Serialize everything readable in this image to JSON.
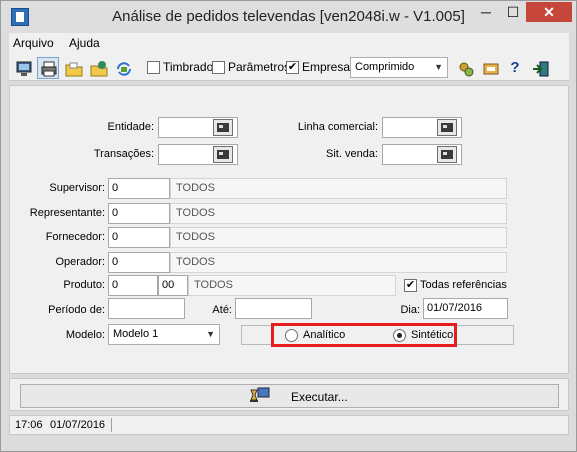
{
  "window": {
    "title": "Análise de pedidos televendas [ven2048i.w - V1.005]",
    "minimize": "─",
    "maximize": "☐",
    "close": "✕"
  },
  "menu": [
    "Arquivo",
    "Ajuda"
  ],
  "toolbar": {
    "timbrado_label": "Timbrado",
    "timbrado_checked": false,
    "parametros_label": "Parâmetros",
    "parametros_checked": false,
    "empresa_label": "Empresa",
    "empresa_checked": true,
    "format_value": "Comprimido",
    "help_glyph": "?"
  },
  "form": {
    "entidade_label": "Entidade:",
    "entidade_value": "",
    "transacoes_label": "Transações:",
    "transacoes_value": "",
    "linha_label": "Linha comercial:",
    "linha_value": "",
    "sitvenda_label": "Sit. venda:",
    "sitvenda_value": "",
    "supervisor_label": "Supervisor:",
    "supervisor_code": "0",
    "supervisor_desc": "TODOS",
    "representante_label": "Representante:",
    "representante_code": "0",
    "representante_desc": "TODOS",
    "fornecedor_label": "Fornecedor:",
    "fornecedor_code": "0",
    "fornecedor_desc": "TODOS",
    "operador_label": "Operador:",
    "operador_code": "0",
    "operador_desc": "TODOS",
    "produto_label": "Produto:",
    "produto_code": "0",
    "produto_sub": "00",
    "produto_desc": "TODOS",
    "todas_ref_label": "Todas referências",
    "todas_ref_checked": true,
    "periodo_label": "Período de:",
    "periodo_value": "",
    "ate_label": "Até:",
    "ate_value": "",
    "dia_label": "Dia:",
    "dia_value": "01/07/2016",
    "modelo_label": "Modelo:",
    "modelo_value": "Modelo 1",
    "analitico_label": "Analítico",
    "sintetico_label": "Sintético",
    "selected_mode": "Sintético"
  },
  "execute": {
    "label": "Executar..."
  },
  "status": {
    "time": "17:06",
    "date": "01/07/2016"
  }
}
